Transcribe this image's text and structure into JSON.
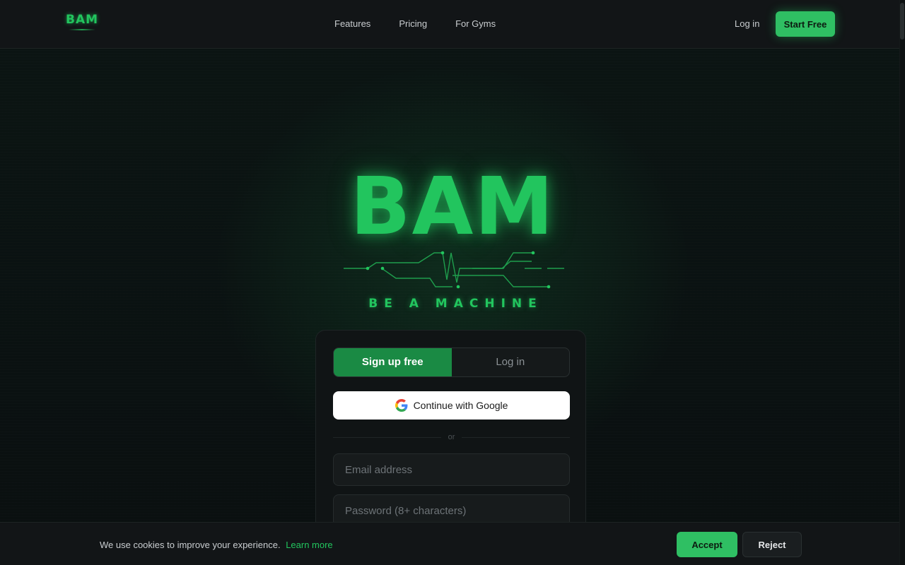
{
  "brand": {
    "logo_text": "BAM",
    "tagline": "BE A MACHINE",
    "accent": "#22c55e"
  },
  "header": {
    "nav": [
      "Features",
      "Pricing",
      "For Gyms"
    ],
    "login_label": "Log in",
    "start_label": "Start Free"
  },
  "auth": {
    "tabs": [
      {
        "label": "Sign up free",
        "active": true
      },
      {
        "label": "Log in",
        "active": false
      }
    ],
    "google_label": "Continue with Google",
    "divider_text": "or",
    "email_placeholder": "Email address",
    "password_placeholder": "Password (8+ characters)"
  },
  "cookie": {
    "message": "We use cookies to improve your experience.",
    "link_label": "Learn more",
    "accept_label": "Accept",
    "reject_label": "Reject"
  },
  "icons": {
    "google": "google-icon"
  }
}
